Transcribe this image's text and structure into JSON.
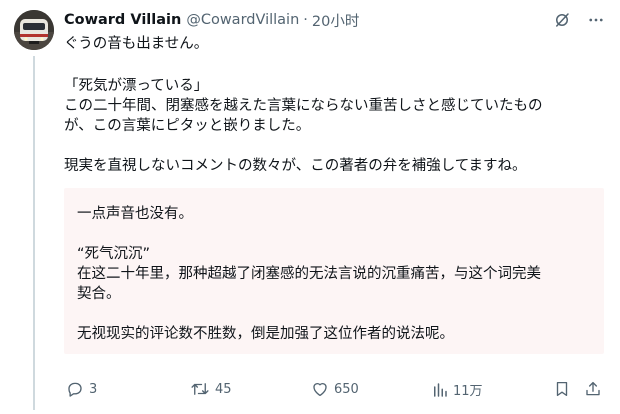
{
  "tweet": {
    "author_name": "Coward Villain",
    "author_handle": "@CowardVillain",
    "separator": "·",
    "time": "20小时",
    "first_line": "ぐうの音も出ません。",
    "quote_lines": [
      "「死気が漂っている」",
      "この二十年間、閉塞感を越えた言葉にならない重苦しさと感じていたもの",
      "が、この言葉にピタッと嵌りました。",
      "",
      "現実を直視しないコメントの数々が、この著者の弁を補強してますね。"
    ],
    "translation_lines": [
      "一点声音也没有。",
      "",
      "“死气沉沉”",
      "在这二十年里，那种超越了闭塞感的无法言说的沉重痛苦，与这个词完美",
      "契合。",
      "",
      "无视现实的评论数不胜数，倒是加强了这位作者的说法呢。"
    ],
    "actions": {
      "reply_count": "3",
      "retweet_count": "45",
      "like_count": "650",
      "views_count": "11万"
    }
  },
  "icons": {
    "top": [
      "grok-icon",
      "more-icon"
    ],
    "actions": [
      "reply-icon",
      "retweet-icon",
      "like-icon",
      "views-icon",
      "bookmark-icon",
      "share-icon"
    ]
  },
  "colors": {
    "text": "#0f1419",
    "secondary": "#536471",
    "translation_bg": "#fdf5f5",
    "thread_line": "#cfd9de"
  }
}
